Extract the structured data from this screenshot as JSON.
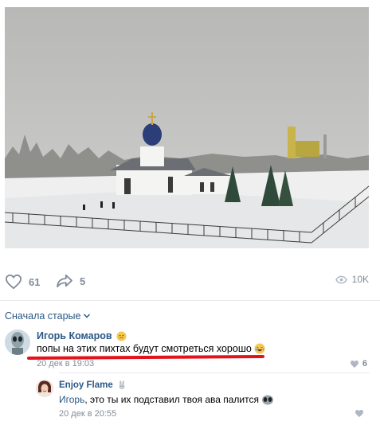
{
  "post": {
    "photo_alt": "",
    "likes": "61",
    "shares": "5",
    "views": "10K"
  },
  "comments_sort": "Сначала старые",
  "comments": [
    {
      "author": "Игорь Комаров",
      "text": "попы на этих пихтах будут смотреться хорошо",
      "date": "20 дек в 19:03",
      "likes": "6"
    },
    {
      "author": "Enjoy Flame",
      "mention": "Игорь",
      "text": ", это ты их подставил твоя ава палится",
      "date": "20 дек в 20:55",
      "likes": ""
    }
  ],
  "colors": {
    "link": "#2a5885",
    "muted": "#818c99",
    "divider": "#e7e8ec",
    "underline": "#e2131b"
  },
  "icons": [
    "heart-icon",
    "share-arrow-icon",
    "eye-icon",
    "chevron-down-icon",
    "emoji-icon",
    "alien-emoji-icon",
    "rabbit-icon"
  ]
}
